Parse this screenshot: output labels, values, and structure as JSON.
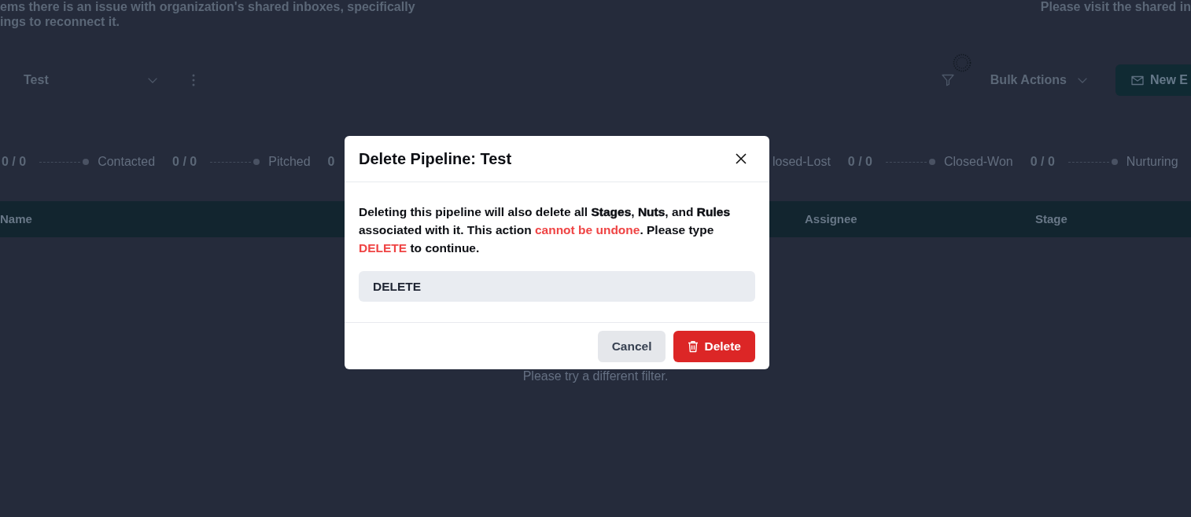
{
  "banner": {
    "line_1_start": "ems there is an issue with organization's shared inboxes, specifically",
    "line_1_end": "Please visit the shared in",
    "line_2": "ings to reconnect it."
  },
  "toolbar": {
    "pipeline_select": {
      "value": "Test"
    },
    "bulk_actions": "Bulk Actions",
    "new_button": "New E"
  },
  "stages_left": [
    {
      "count": "0 / 0"
    },
    {
      "name": "Contacted",
      "count": "0 / 0"
    },
    {
      "name": "Pitched",
      "count": "0"
    }
  ],
  "stages_right": [
    {
      "name": "losed-Lost",
      "count": "0 / 0"
    },
    {
      "name": "Closed-Won",
      "count": "0 / 0"
    },
    {
      "name": "Nurturing"
    }
  ],
  "table": {
    "columns": [
      "Name",
      "Assignee",
      "Stage"
    ],
    "empty_message": "Please try a different filter."
  },
  "dialog": {
    "title": "Delete Pipeline: Test",
    "message": [
      {
        "kind": "plain",
        "text": "Deleting this pipeline will also delete all **Stages**, **Nuts**, and **Rules** associated with it. This action "
      },
      {
        "kind": "danger",
        "text": "cannot be undone"
      },
      {
        "kind": "plain",
        "text": ". Please type "
      },
      {
        "kind": "danger",
        "text": "DELETE"
      },
      {
        "kind": "plain",
        "text": " to continue."
      }
    ],
    "input": {
      "value": "DELETE"
    },
    "buttons": [
      {
        "label": "Cancel",
        "kind": "secondary"
      },
      {
        "label": "Delete",
        "kind": "danger"
      }
    ]
  }
}
